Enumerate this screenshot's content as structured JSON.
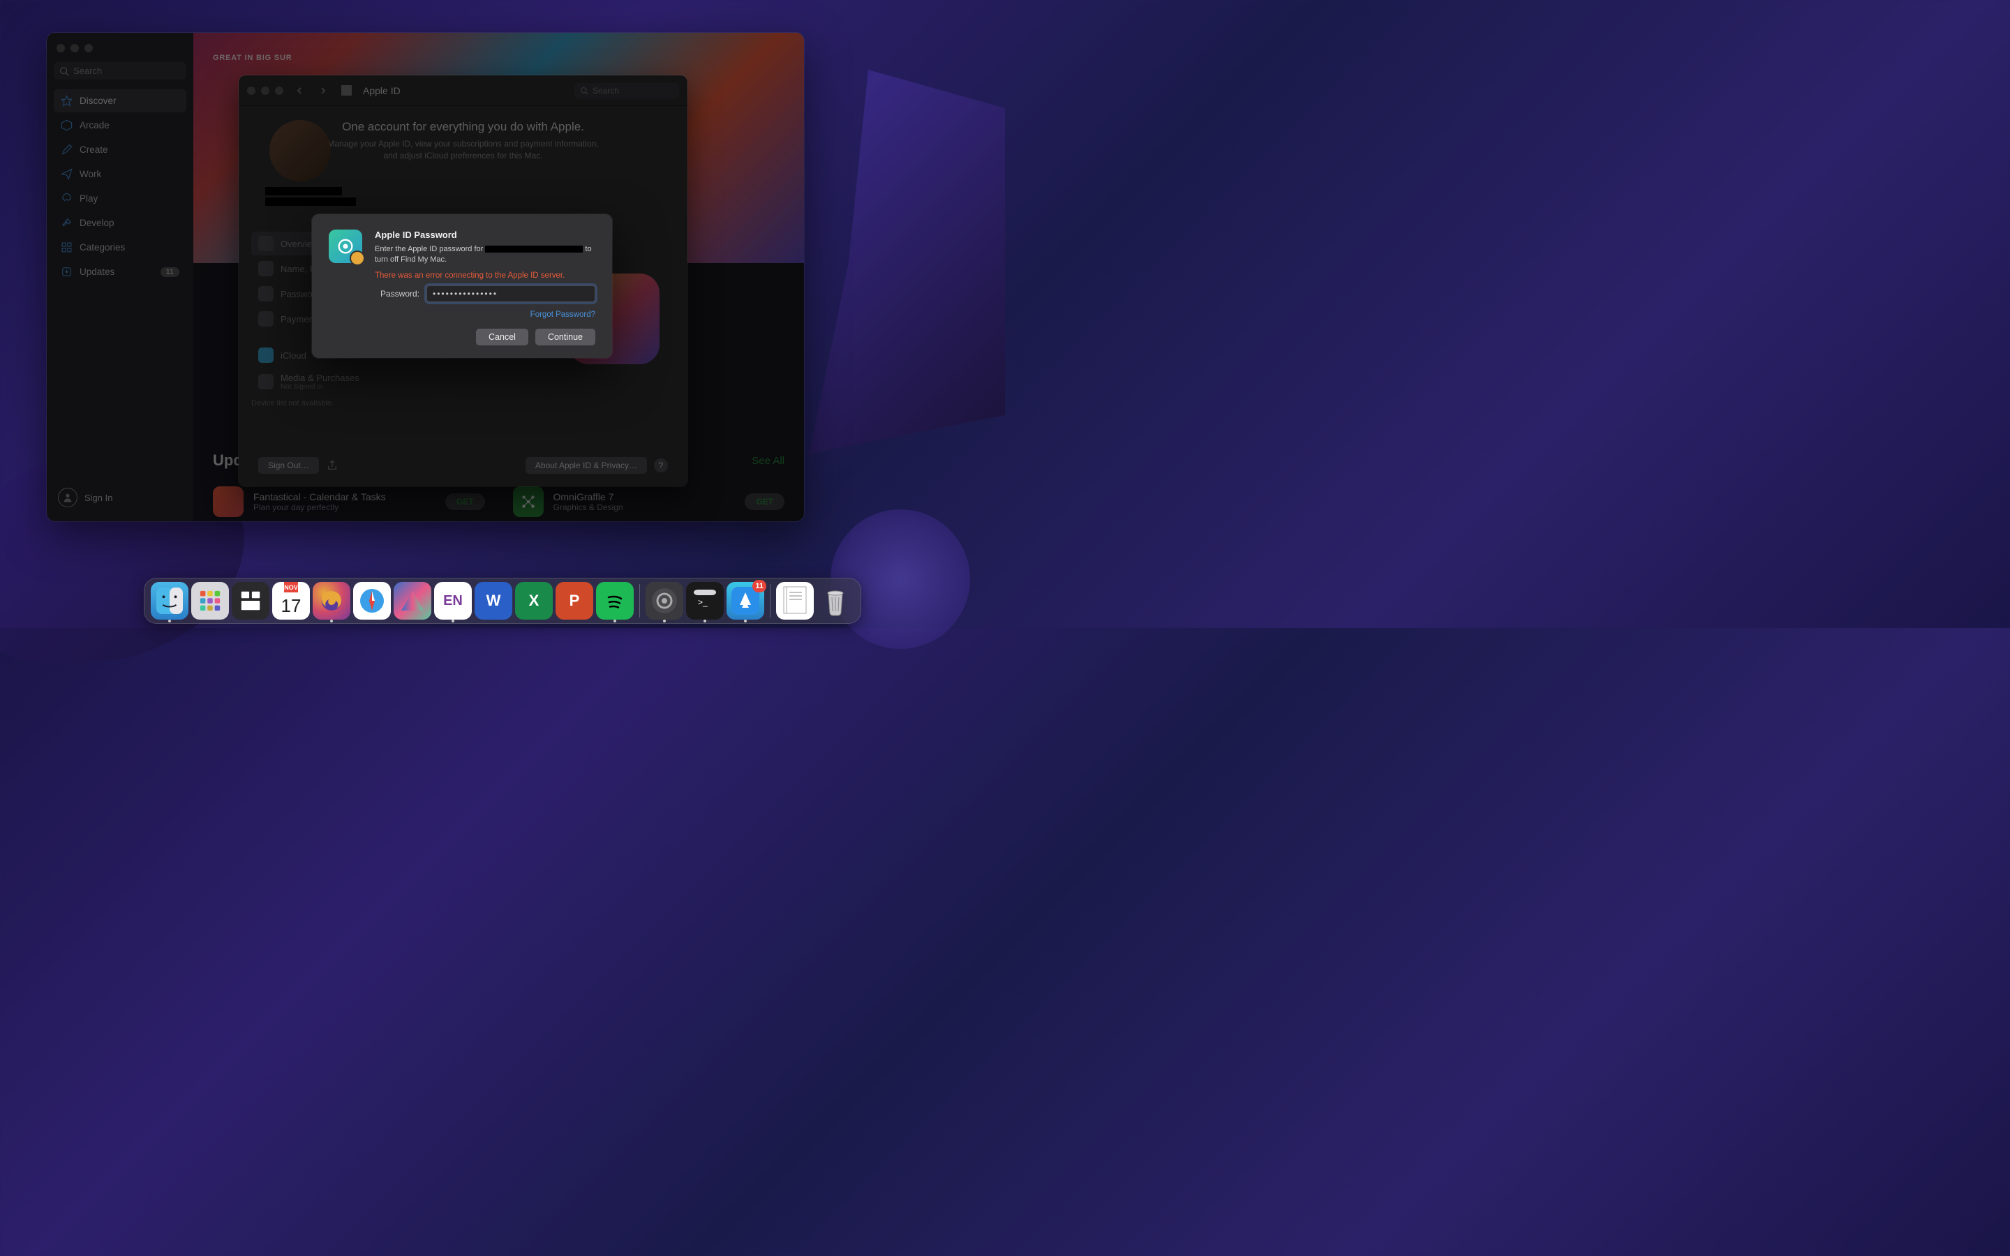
{
  "appstore": {
    "search_placeholder": "Search",
    "nav": [
      {
        "label": "Discover"
      },
      {
        "label": "Arcade"
      },
      {
        "label": "Create"
      },
      {
        "label": "Work"
      },
      {
        "label": "Play"
      },
      {
        "label": "Develop"
      },
      {
        "label": "Categories"
      },
      {
        "label": "Updates",
        "badge": "11"
      }
    ],
    "signin": "Sign In",
    "hero_label": "GREAT IN BIG SUR",
    "updates_heading": "Updates",
    "see_all": "See All",
    "apps": [
      {
        "name": "Fantastical - Calendar & Tasks",
        "sub": "Plan your day perfectly",
        "btn": "GET"
      },
      {
        "name": "OmniGraffle 7",
        "sub": "Graphics & Design",
        "btn": "GET"
      }
    ]
  },
  "sysprefs": {
    "title": "Apple ID",
    "search_placeholder": "Search",
    "header_title": "One account for everything you do with Apple.",
    "header_sub": "Manage your Apple ID, view your subscriptions and payment information, and adjust iCloud preferences for this Mac.",
    "tabs": [
      {
        "label": "Overview"
      },
      {
        "label": "Name, Phone, Email"
      },
      {
        "label": "Password & Security"
      },
      {
        "label": "Payment & Shipping"
      },
      {
        "label": "iCloud"
      },
      {
        "label": "Media & Purchases",
        "sub": "Not Signed In"
      }
    ],
    "device_note": "Device list not available.",
    "signout_btn": "Sign Out…",
    "about_btn": "About Apple ID & Privacy…"
  },
  "modal": {
    "title": "Apple ID Password",
    "desc_prefix": "Enter the Apple ID password for ",
    "desc_suffix": " to turn off Find My Mac.",
    "error": "There was an error connecting to the Apple ID server.",
    "password_label": "Password:",
    "password_value": "•••••••••••••••",
    "forgot": "Forgot Password?",
    "cancel": "Cancel",
    "continue": "Continue"
  },
  "dock": {
    "cal_month": "NOV",
    "cal_day": "17",
    "en_label": "EN",
    "word_label": "W",
    "excel_label": "X",
    "ppt_label": "P",
    "appstore_badge": "11"
  }
}
